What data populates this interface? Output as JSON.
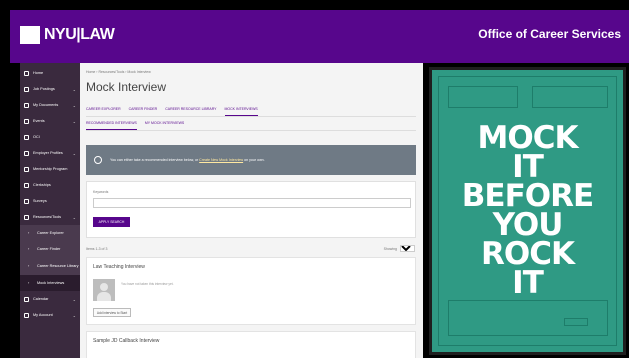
{
  "header": {
    "logo_text": "NYU|LAW",
    "title": "Office of Career Services"
  },
  "sidebar": {
    "items": [
      {
        "label": "Home",
        "icon": "home-icon"
      },
      {
        "label": "Job Postings",
        "icon": "briefcase-icon"
      },
      {
        "label": "My Documents",
        "icon": "document-icon"
      },
      {
        "label": "Events",
        "icon": "pin-icon"
      },
      {
        "label": "OCI",
        "icon": "people-icon"
      },
      {
        "label": "Employer Profiles",
        "icon": "building-icon"
      },
      {
        "label": "Mentorship Program",
        "icon": "mentor-icon"
      },
      {
        "label": "Clerkships",
        "icon": "gavel-icon"
      },
      {
        "label": "Surveys",
        "icon": "list-icon"
      },
      {
        "label": "Resources/Tools",
        "icon": "tools-icon"
      },
      {
        "label": "Career Explorer",
        "icon": "chevron-right-icon"
      },
      {
        "label": "Career Finder",
        "icon": "chevron-right-icon"
      },
      {
        "label": "Career Resource Library",
        "icon": "chevron-right-icon"
      },
      {
        "label": "Mock Interviews",
        "icon": "chevron-right-icon"
      },
      {
        "label": "Calendar",
        "icon": "calendar-icon"
      },
      {
        "label": "My Account",
        "icon": "user-icon"
      }
    ]
  },
  "main": {
    "breadcrumb": "Home › Resources/Tools › Mock Interview",
    "title": "Mock Interview",
    "tabs": [
      "Career Explorer",
      "Career Finder",
      "Career Resource Library",
      "Mock Interviews"
    ],
    "subtabs": [
      "Recommended Interviews",
      "My Mock Interviews"
    ],
    "notice_prefix": "You can either take a recommended interview below, or ",
    "notice_link": "Create New Mock Interview",
    "notice_suffix": " on your own.",
    "keywords_label": "Keywords",
    "keywords_value": "",
    "apply_label": "Apply Search",
    "count_text": "Items 1-3 of 3",
    "showing_label": "Showing",
    "showing_value": "25",
    "cards": [
      {
        "title": "Law Teaching Interview",
        "meta": "You have not taken this interview yet.",
        "button": "Add interview to Start"
      },
      {
        "title": "Sample JD Callback Interview"
      }
    ]
  },
  "poster": {
    "lines": [
      "MOCK",
      "IT",
      "BEFORE",
      "YOU",
      "ROCK",
      "IT"
    ]
  }
}
